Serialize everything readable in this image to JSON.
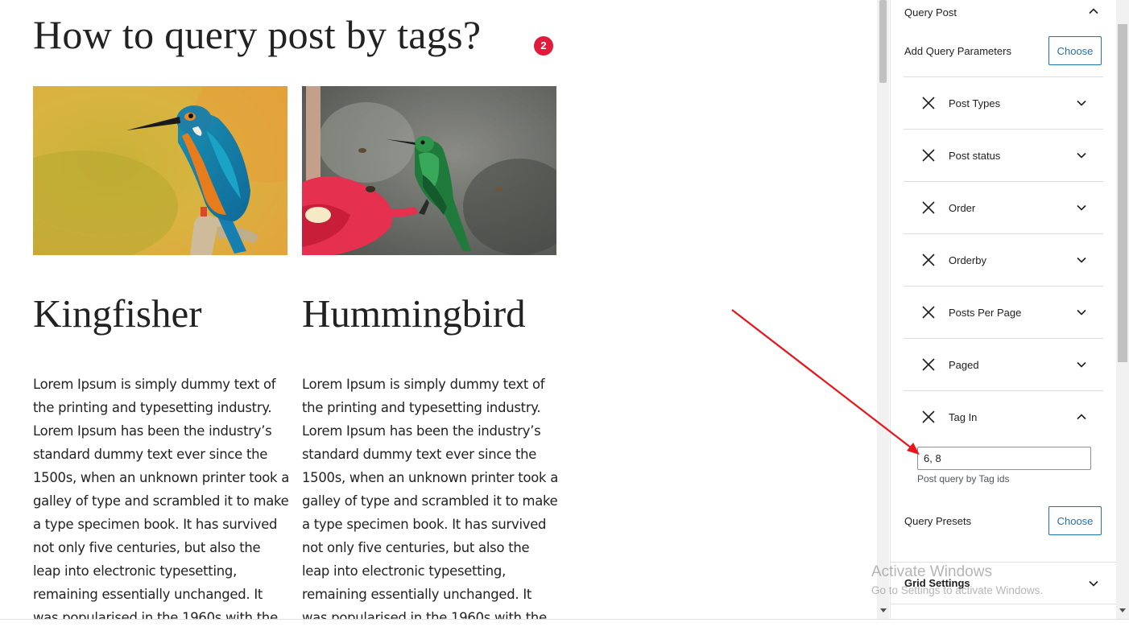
{
  "post": {
    "title": "How to query post by tags?",
    "badge_count": "2",
    "items": [
      {
        "heading": "Kingfisher",
        "body": "Lorem Ipsum is simply dummy text of the printing and typesetting industry. Lorem Ipsum has been the industry’s standard dummy text ever since the 1500s, when an unknown printer took a galley of type and scrambled it to make a type specimen book. It has survived not only five centuries, but also the leap into electronic typesetting, remaining essentially unchanged. It was popularised in the 1960s with the"
      },
      {
        "heading": "Hummingbird",
        "body": "Lorem Ipsum is simply dummy text of the printing and typesetting industry. Lorem Ipsum has been the industry’s standard dummy text ever since the 1500s, when an unknown printer took a galley of type and scrambled it to make a type specimen book. It has survived not only five centuries, but also the leap into electronic typesetting, remaining essentially unchanged. It was popularised in the 1960s with the"
      }
    ]
  },
  "sidebar": {
    "panel_title": "Query Post",
    "add_params_label": "Add Query Parameters",
    "choose_label": "Choose",
    "params": [
      {
        "label": "Post Types",
        "expanded": false
      },
      {
        "label": "Post status",
        "expanded": false
      },
      {
        "label": "Order",
        "expanded": false
      },
      {
        "label": "Orderby",
        "expanded": false
      },
      {
        "label": "Posts Per Page",
        "expanded": false
      },
      {
        "label": "Paged",
        "expanded": false
      },
      {
        "label": "Tag In",
        "expanded": true
      }
    ],
    "tag_in_value": "6, 8",
    "tag_in_help": "Post query by Tag ids",
    "presets_label": "Query Presets",
    "presets_choose_label": "Choose",
    "grid_settings_label": "Grid Settings"
  },
  "watermark": {
    "title": "Activate Windows",
    "subtitle": "Go to Settings to activate Windows."
  },
  "colors": {
    "accent": "#2271b1",
    "badge": "#e01b3c",
    "arrow": "#e8151b"
  }
}
